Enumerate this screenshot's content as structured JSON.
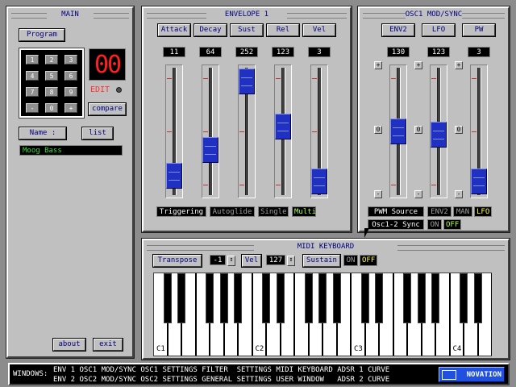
{
  "main": {
    "title": "MAIN",
    "program_label": "Program",
    "keypad": [
      "1",
      "2",
      "3",
      "4",
      "5",
      "6",
      "7",
      "8",
      "9",
      "-",
      "0",
      "+"
    ],
    "led_value": "00",
    "edit_label": "EDIT",
    "compare_label": "compare",
    "name_label": "Name :",
    "list_label": "list",
    "patch_name": "Moog Bass",
    "about_label": "about",
    "exit_label": "exit"
  },
  "envelope": {
    "title": "ENVELOPE 1",
    "params": [
      {
        "label": "Attack",
        "value": "11",
        "level": 0.08
      },
      {
        "label": "Decay",
        "value": "64",
        "level": 0.32
      },
      {
        "label": "Sust",
        "value": "252",
        "level": 0.98
      },
      {
        "label": "Rel",
        "value": "123",
        "level": 0.55
      },
      {
        "label": "Vel",
        "value": "3",
        "level": 0.02
      }
    ],
    "modes": [
      {
        "label": "Triggering",
        "state": "on"
      },
      {
        "label": "Autoglide",
        "state": "off"
      },
      {
        "label": "Single",
        "state": "off"
      },
      {
        "label": "Multi",
        "state": "lime"
      }
    ]
  },
  "osc1": {
    "title": "OSC1 MOD/SYNC",
    "params": [
      {
        "label": "ENV2",
        "value": "130",
        "level": 0.5
      },
      {
        "label": "LFO",
        "value": "123",
        "level": 0.47
      },
      {
        "label": "PW",
        "value": "3",
        "level": 0.02
      }
    ],
    "plus": "+",
    "zero": "0",
    "minus": "-",
    "pwm_source_label": "PWM Source",
    "pwm_sources": [
      {
        "label": "ENV2",
        "state": "off"
      },
      {
        "label": "MAN",
        "state": "off"
      },
      {
        "label": "LFO",
        "state": "yellow"
      }
    ],
    "sync_label": "Osc1-2 Sync",
    "sync_on": "ON",
    "sync_off": "OFF"
  },
  "midi": {
    "title": "MIDI KEYBOARD",
    "transpose_label": "Transpose",
    "transpose_value": "-1",
    "vel_label": "Vel",
    "vel_value": "127",
    "sustain_label": "Sustain",
    "sustain_on": "ON",
    "sustain_off": "OFF",
    "octaves": [
      "C1",
      "C2",
      "C3",
      "C4"
    ]
  },
  "windows": {
    "label": "WINDOWS:",
    "row1": "ENV 1 OSC1 MOD/SYNC OSC1 SETTINGS FILTER  SETTINGS MIDI KEYBOARD ADSR 1 CURVE",
    "row2": "ENV 2 OSC2 MOD/SYNC OSC2 SETTINGS GENERAL SETTINGS USER WINDOW   ADSR 2 CURVE",
    "brand": "NOVATION"
  }
}
